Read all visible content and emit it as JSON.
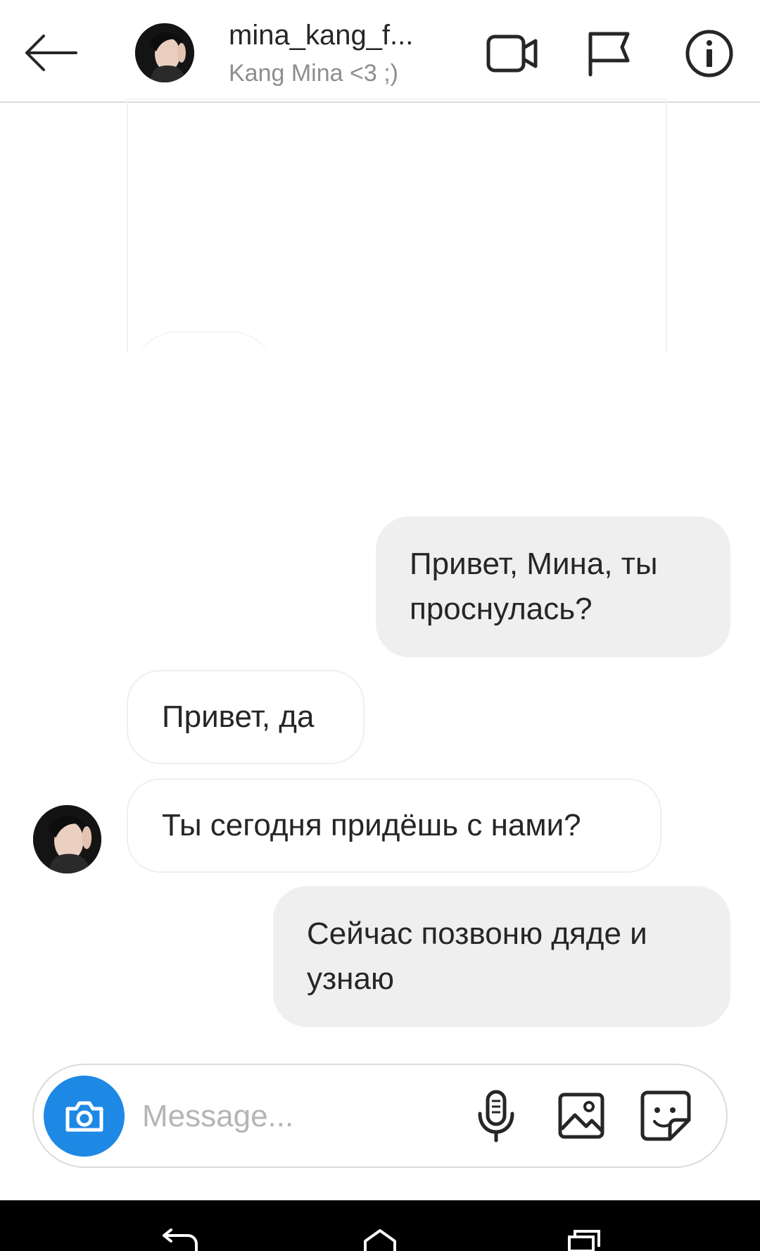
{
  "header": {
    "title": "mina_kang_f...",
    "subtitle": "Kang Mina <3 ;)",
    "icons": [
      "arrow-left-icon",
      "video-camera-icon",
      "flag-icon",
      "info-icon"
    ]
  },
  "messages": [
    {
      "direction": "outgoing",
      "text": "Привет, Мина, ты проснулась?"
    },
    {
      "direction": "incoming",
      "text": "Привет, да"
    },
    {
      "direction": "incoming",
      "text": "Ты сегодня придёшь с нами?"
    },
    {
      "direction": "outgoing",
      "text": "Сейчас позвоню дяде и узнаю"
    }
  ],
  "composer": {
    "placeholder": "Message...",
    "icons": [
      "camera-icon",
      "microphone-icon",
      "image-icon",
      "sticker-icon"
    ]
  },
  "colors": {
    "accent": "#1e88e5",
    "outgoing_bubble": "#efefef",
    "incoming_border": "#efefef",
    "subtitle": "#8e8e8e"
  }
}
